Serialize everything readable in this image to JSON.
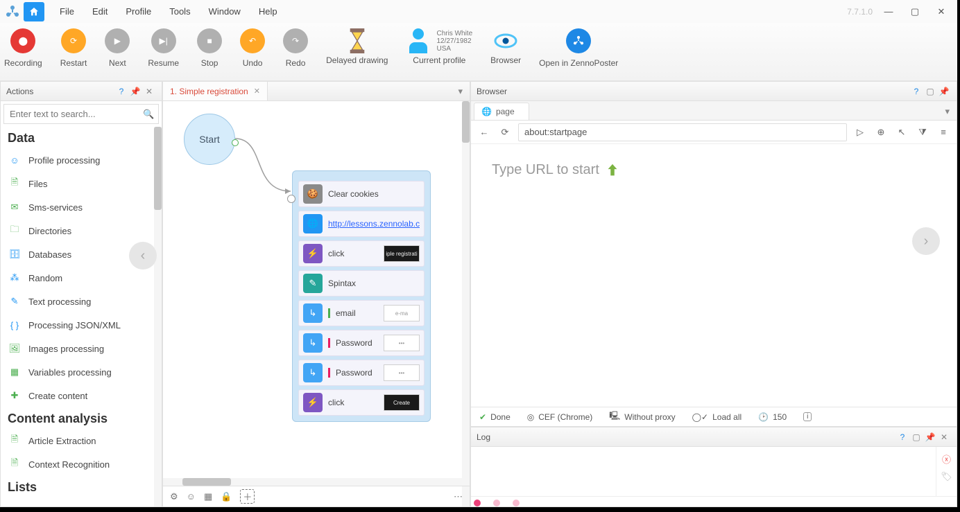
{
  "menubar": {
    "items": [
      "File",
      "Edit",
      "Profile",
      "Tools",
      "Window",
      "Help"
    ]
  },
  "version": "7.7.1.0",
  "toolbar": {
    "recording": "Recording",
    "restart": "Restart",
    "next": "Next",
    "resume": "Resume",
    "stop": "Stop",
    "undo": "Undo",
    "redo": "Redo",
    "delayed": "Delayed drawing",
    "profile": "Current profile",
    "profile_meta": {
      "name": "Chris White",
      "dob": "12/27/1982",
      "country": "USA"
    },
    "browser": "Browser",
    "openzp": "Open in ZennoPoster"
  },
  "actions": {
    "title": "Actions",
    "search_placeholder": "Enter text to search...",
    "groups": [
      {
        "head": "Data",
        "items": [
          "Profile processing",
          "Files",
          "Sms-services",
          "Directories",
          "Databases",
          "Random",
          "Text processing",
          "Processing JSON/XML",
          "Images processing",
          "Variables processing",
          "Create content"
        ]
      },
      {
        "head": "Content analysis",
        "items": [
          "Article Extraction",
          "Context Recognition"
        ]
      },
      {
        "head": "Lists",
        "items": []
      }
    ]
  },
  "canvas": {
    "tab": "1. Simple registration",
    "start": "Start",
    "nodes": [
      {
        "icon": "cookie",
        "color": "c-grey",
        "text": "Clear cookies"
      },
      {
        "icon": "globe",
        "color": "c-blue",
        "link": "http://lessons.zennolab.com/en/index"
      },
      {
        "icon": "flash",
        "color": "c-purple",
        "text": "click",
        "thumb": "dark",
        "thumb_text": "iple registrati"
      },
      {
        "icon": "pencil",
        "color": "c-green",
        "text": "Spintax"
      },
      {
        "icon": "arrow",
        "color": "c-lblue",
        "bar": "g",
        "text": "email",
        "thumb": "light",
        "thumb_text": "e-ma"
      },
      {
        "icon": "arrow",
        "color": "c-lblue",
        "bar": "p",
        "text": "Password",
        "thumb": "light",
        "thumb_text": "•••"
      },
      {
        "icon": "arrow",
        "color": "c-lblue",
        "bar": "p",
        "text": "Password",
        "thumb": "light",
        "thumb_text": "•••"
      },
      {
        "icon": "flash",
        "color": "c-purple",
        "text": "click",
        "thumb": "dark",
        "thumb_text": "Create"
      }
    ]
  },
  "browser": {
    "title": "Browser",
    "tab": "page",
    "url": "about:startpage",
    "placeholder_msg": "Type URL to start",
    "status": {
      "done": "Done",
      "engine": "CEF (Chrome)",
      "proxy": "Without proxy",
      "load": "Load all",
      "num": "150"
    }
  },
  "log": {
    "title": "Log"
  }
}
